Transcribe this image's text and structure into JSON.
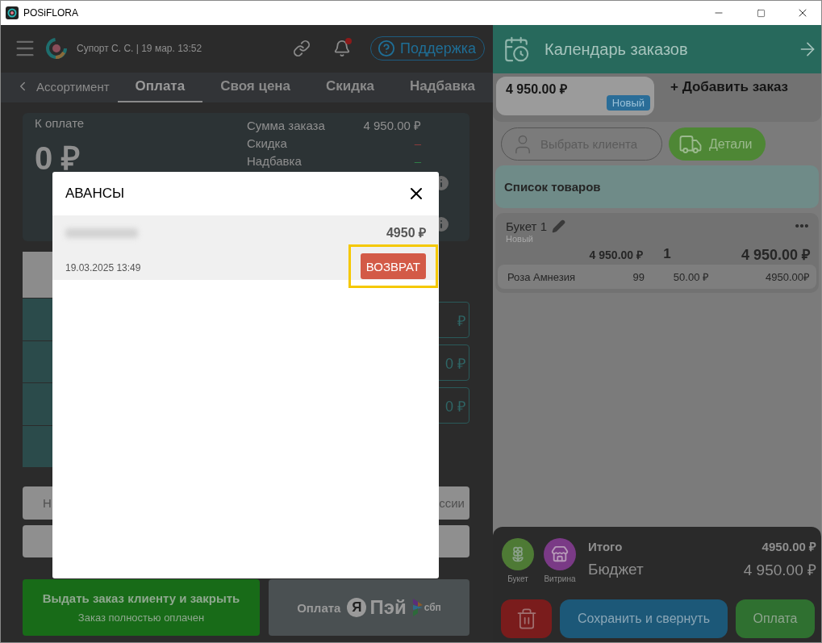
{
  "window": {
    "title": "POSiFLORA"
  },
  "header": {
    "user": "Супорт С. С. | 19 мар. 13:52",
    "notification": true,
    "support": "Поддержка"
  },
  "tabs": [
    {
      "label": "Ассортимент",
      "kind": "back",
      "selected": false
    },
    {
      "label": "Оплата",
      "kind": "tab",
      "selected": true
    },
    {
      "label": "Своя цена",
      "kind": "tab",
      "selected": false
    },
    {
      "label": "Скидка",
      "kind": "tab",
      "selected": false
    },
    {
      "label": "Надбавка",
      "kind": "tab",
      "selected": false
    }
  ],
  "summary": {
    "label": "К оплате",
    "amount": "0 ₽",
    "lines": [
      {
        "label": "Сумма заказа",
        "value": "4 950.00 ₽"
      },
      {
        "label": "Скидка",
        "value": "–",
        "color": "#8a3b3b"
      },
      {
        "label": "Надбавка",
        "value": "–",
        "color": "#2f7d47"
      }
    ]
  },
  "payment_fields": [
    "₽",
    "0 ₽",
    "0 ₽"
  ],
  "payment_buttons": [
    "Н",
    "ссии"
  ],
  "close_order": {
    "title": "Выдать заказ клиенту и закрыть",
    "subtitle": "Заказ полностью оплачен"
  },
  "pay_button": {
    "label": "Оплата",
    "logo_letter": "Я",
    "logo_word": "Пэй",
    "sbp": "сбп"
  },
  "modal": {
    "title": "АВАНСЫ",
    "advances": [
      {
        "amount": "4950 ₽",
        "date": "19.03.2025 13:49",
        "action": "ВОЗВРАТ",
        "highlighted": true
      }
    ]
  },
  "calendar": {
    "title": "Календарь заказов"
  },
  "orders": [
    {
      "amount": "4 950.00 ₽",
      "status": "Новый",
      "selected": true
    }
  ],
  "add_order": "+ Добавить заказ",
  "client_button": "Выбрать клиента",
  "details_button": "Детали",
  "products": {
    "title": "Список товаров",
    "bouquets": [
      {
        "name": "Букет 1",
        "status": "Новый",
        "price": "4 950.00 ₽",
        "quantity": "1",
        "total": "4 950.00 ₽",
        "items": [
          {
            "name": "Роза Амнезия",
            "quantity": "99",
            "price": "50.00 ₽",
            "total": "4950.00₽"
          }
        ]
      }
    ]
  },
  "footer": {
    "shortcuts": [
      {
        "label": "Букет",
        "kind": "bouquet",
        "color": "#4e7a35"
      },
      {
        "label": "Витрина",
        "kind": "showcase",
        "color": "#7a3a86"
      }
    ],
    "totals": [
      {
        "label": "Итого",
        "value": "4950.00 ₽",
        "bold": true
      },
      {
        "label": "Бюджет",
        "value": "4 950.00 ₽",
        "bold": false
      }
    ],
    "buttons": [
      {
        "kind": "delete"
      },
      {
        "kind": "save",
        "label": "Сохранить и свернуть"
      },
      {
        "kind": "pay",
        "label": "Оплата"
      }
    ]
  }
}
